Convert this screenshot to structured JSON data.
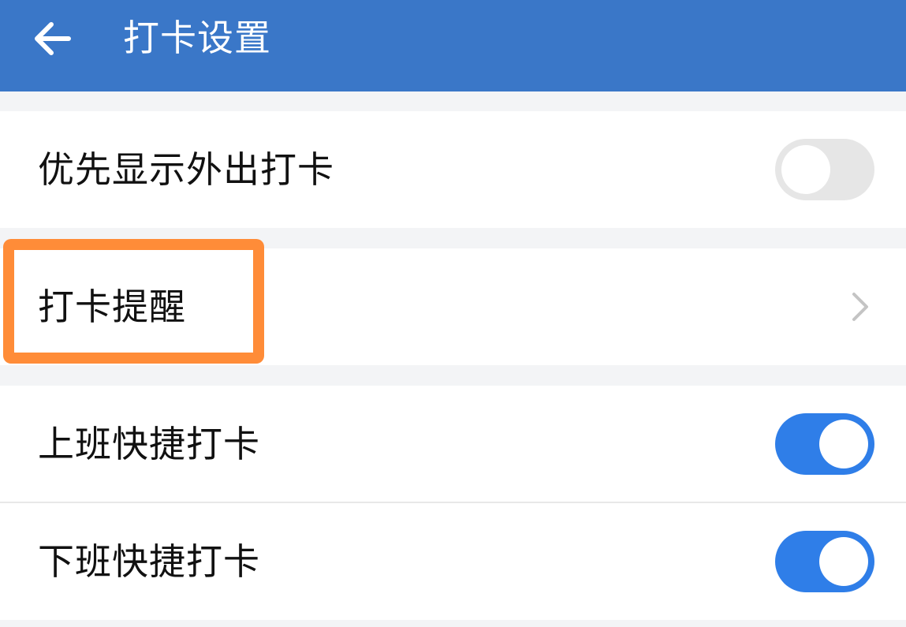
{
  "header": {
    "title": "打卡设置",
    "back_icon": "arrow-left-icon",
    "background_color": "#3a77c8"
  },
  "settings": [
    {
      "label": "优先显示外出打卡",
      "control": "toggle",
      "enabled": false
    },
    {
      "label": "打卡提醒",
      "control": "chevron",
      "icon": "chevron-right-icon"
    },
    {
      "label": "上班快捷打卡",
      "control": "toggle",
      "enabled": true
    },
    {
      "label": "下班快捷打卡",
      "control": "toggle",
      "enabled": true
    }
  ],
  "colors": {
    "toggle_on": "#2f7ee8",
    "toggle_off": "#e6e6e6",
    "highlight": "#ff8c38"
  }
}
